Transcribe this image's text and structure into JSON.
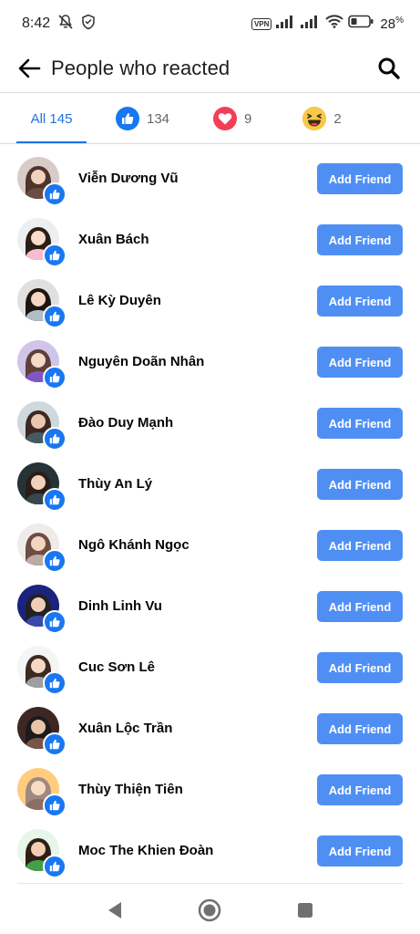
{
  "status_bar": {
    "time": "8:42",
    "vpn_label": "VPN",
    "battery_percent": "28",
    "battery_unit": "%",
    "icons": [
      "mute-icon",
      "shield-icon",
      "signal-icon",
      "wifi-icon",
      "battery-icon"
    ]
  },
  "header": {
    "title": "People who reacted",
    "back_icon": "arrow-left-icon",
    "search_icon": "search-icon"
  },
  "tabs": [
    {
      "label": "All 145",
      "active": true
    },
    {
      "icon": "like-icon",
      "count": "134"
    },
    {
      "icon": "love-icon",
      "count": "9"
    },
    {
      "icon": "haha-icon",
      "count": "2"
    }
  ],
  "people": [
    {
      "name": "Viễn Dương Vũ",
      "button": "Add Friend"
    },
    {
      "name": "Xuân Bách",
      "button": "Add Friend"
    },
    {
      "name": "Lê Kỳ Duyên",
      "button": "Add Friend"
    },
    {
      "name": "Nguyên Doãn Nhân",
      "button": "Add Friend"
    },
    {
      "name": "Đào Duy Mạnh",
      "button": "Add Friend"
    },
    {
      "name": "Thùy An Lý",
      "button": "Add Friend"
    },
    {
      "name": "Ngô Khánh Ngọc",
      "button": "Add Friend"
    },
    {
      "name": "Dinh Linh Vu",
      "button": "Add Friend"
    },
    {
      "name": "Cuc Sơn Lê",
      "button": "Add Friend"
    },
    {
      "name": "Xuân Lộc Trần",
      "button": "Add Friend"
    },
    {
      "name": "Thùy Thiện Tiên",
      "button": "Add Friend"
    },
    {
      "name": "Moc The Khien Đoàn",
      "button": "Add Friend"
    }
  ],
  "nav_bar": {
    "icons": [
      "nav-back-icon",
      "nav-home-icon",
      "nav-recents-icon"
    ]
  },
  "colors": {
    "accent": "#1b74e4",
    "button": "#4f8ff3",
    "like": "#1877f2",
    "love": "#f33e58",
    "haha": "#f7b125"
  }
}
